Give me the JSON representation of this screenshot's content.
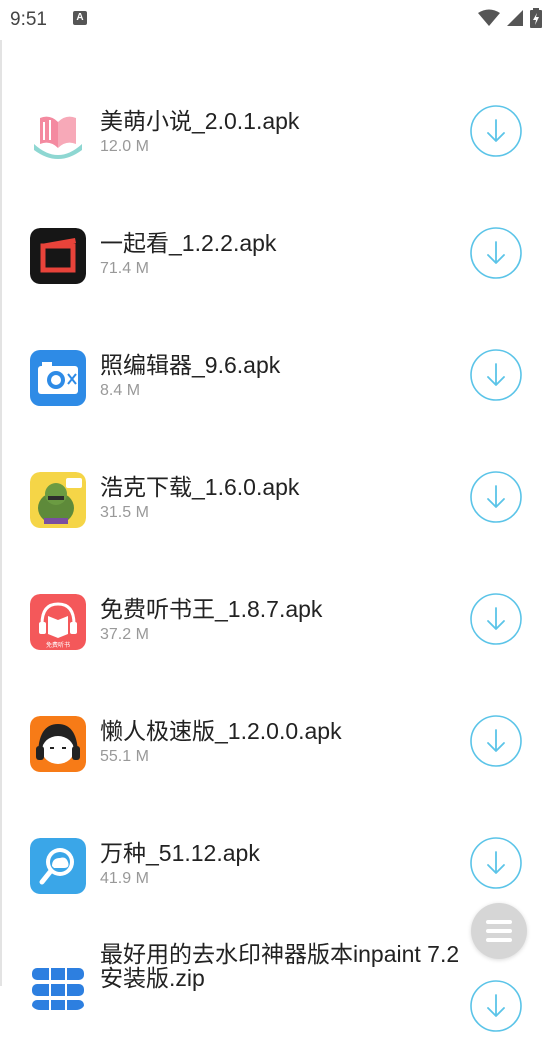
{
  "status_bar": {
    "time": "9:51",
    "notif_letter": "A"
  },
  "files": [
    {
      "name": "美萌小说_2.0.1.apk",
      "size": "12.0 M",
      "icon": "book-icon"
    },
    {
      "name": "一起看_1.2.2.apk",
      "size": "71.4 M",
      "icon": "video-icon"
    },
    {
      "name": "照编辑器_9.6.apk",
      "size": "8.4 M",
      "icon": "camera-icon"
    },
    {
      "name": "浩克下载_1.6.0.apk",
      "size": "31.5 M",
      "icon": "hulk-icon"
    },
    {
      "name": "免费听书王_1.8.7.apk",
      "size": "37.2 M",
      "icon": "headphone-book-icon",
      "icon_caption": "免费听书"
    },
    {
      "name": "懒人极速版_1.2.0.0.apk",
      "size": "55.1 M",
      "icon": "lazy-face-icon"
    },
    {
      "name": "万种_51.12.apk",
      "size": "41.9 M",
      "icon": "search-cloud-icon"
    },
    {
      "name": "最好用的去水印神器版本inpaint 7.2安装版.zip",
      "size": "",
      "icon": "database-icon"
    }
  ],
  "colors": {
    "accent": "#5bc4e8",
    "size_text": "#999999",
    "fab": "#d6d6d6"
  }
}
